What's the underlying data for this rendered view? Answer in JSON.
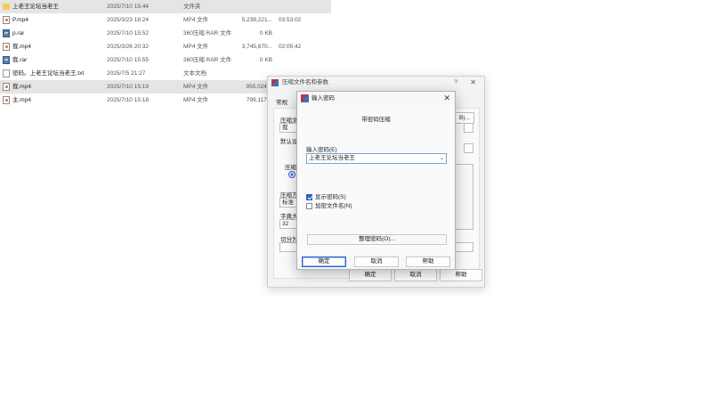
{
  "files": [
    {
      "icon": "folder-icon",
      "name": "上老王论坛当老王",
      "date": "2025/7/10 15:44",
      "type": "文件夹",
      "size": "",
      "duration": "",
      "selected": true
    },
    {
      "icon": "mp4-file-icon",
      "name": "P.mp4",
      "date": "2025/3/23 18:24",
      "type": "MP4 文件",
      "size": "5,239,221...",
      "duration": "03:53:02",
      "selected": false
    },
    {
      "icon": "rar-file-icon",
      "name": "p.rar",
      "date": "2025/7/10 15:52",
      "type": "360压缩 RAR 文件",
      "size": "0 KB",
      "duration": "",
      "selected": false
    },
    {
      "icon": "mp4-file-icon",
      "name": "我.mp4",
      "date": "2025/3/26 20:32",
      "type": "MP4 文件",
      "size": "3,745,670...",
      "duration": "02:05:42",
      "selected": false
    },
    {
      "icon": "rar-file-icon",
      "name": "我.rar",
      "date": "2025/7/10 15:55",
      "type": "360压缩 RAR 文件",
      "size": "0 KB",
      "duration": "",
      "selected": false
    },
    {
      "icon": "text-file-icon",
      "name": "密码。上老王论坛当老王.txt",
      "date": "2025/7/5 21:27",
      "type": "文本文档",
      "size": "",
      "duration": "",
      "selected": false
    },
    {
      "icon": "mp4-file-icon",
      "name": "我.mp4",
      "date": "2025/7/10 15:19",
      "type": "MP4 文件",
      "size": "955,024 K",
      "duration": "",
      "selected": true
    },
    {
      "icon": "mp4-file-icon",
      "name": "主.mp4",
      "date": "2025/7/10 15:18",
      "type": "MP4 文件",
      "size": "799,117 K",
      "duration": "",
      "selected": false
    }
  ],
  "bg_dialog": {
    "title": "压缩文件名和参数",
    "help": "?",
    "close": "✕",
    "tab_general": "常规",
    "label_archive": "压缩文",
    "archive_value": "我",
    "browse_fragment": "B)...",
    "label_default": "默认设",
    "label_format": "压缩",
    "label_method": "压缩方",
    "method_value": "标准",
    "label_dict": "字典大",
    "dict_value": "32",
    "label_split": "切分为",
    "ok": "确定",
    "cancel": "取消",
    "help_btn": "帮助"
  },
  "pw_dialog": {
    "title": "输入密码",
    "close": "✕",
    "heading": "带密码压缩",
    "label": "输入密码(E)",
    "password_value": "上老王论坛当老王",
    "show_password_label": "显示密码(S)",
    "show_password_checked": true,
    "encrypt_names_label": "加密文件名(N)",
    "encrypt_names_checked": false,
    "organize_button": "整理密码(O)...",
    "ok": "确定",
    "cancel": "取消",
    "help": "帮助"
  }
}
